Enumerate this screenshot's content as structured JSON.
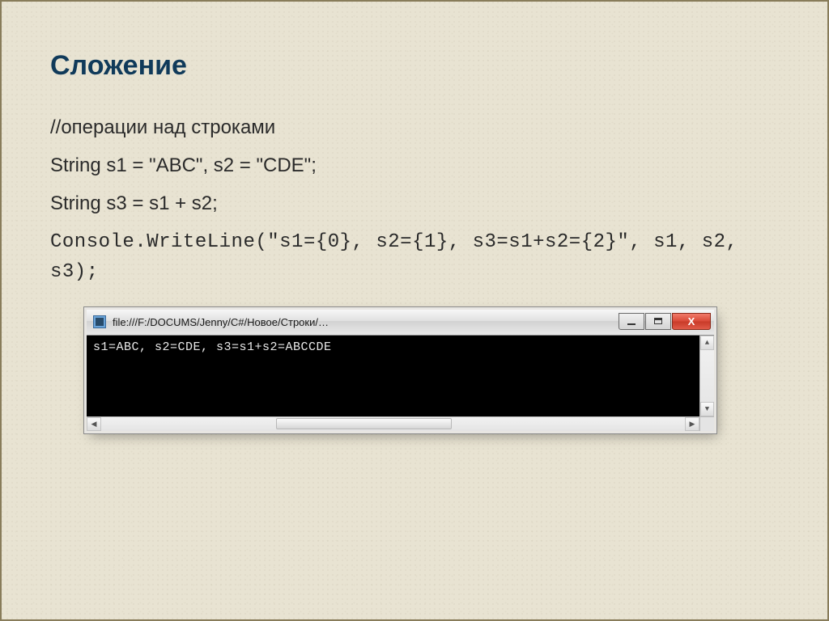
{
  "slide": {
    "title": "Сложение",
    "body_1": "//операции над строками",
    "body_2": "String s1 = \"ABC\", s2 = \"CDE\";",
    "body_3": "String s3 = s1 + s2;",
    "body_4": "Console.WriteLine(\"s1={0}, s2={1}, s3=s1+s2={2}\", s1, s2, s3);"
  },
  "console": {
    "title": "file:///F:/DOCUMS/Jenny/C#/Новое/Строки/…",
    "output": "s1=ABC, s2=CDE, s3=s1+s2=ABCCDE",
    "close_glyph": "X",
    "up_glyph": "▲",
    "down_glyph": "▼",
    "left_glyph": "◀",
    "right_glyph": "▶"
  }
}
